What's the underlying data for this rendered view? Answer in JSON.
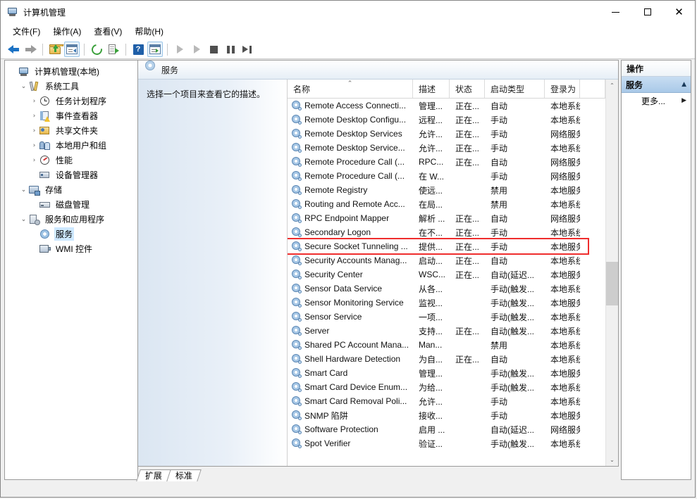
{
  "window": {
    "title": "计算机管理",
    "title_icon": "computer-management-icon",
    "controls": {
      "minimize": "—",
      "maximize": "□",
      "close": "✕"
    }
  },
  "menubar": [
    {
      "name": "file",
      "label": "文件(F)",
      "accel": "F"
    },
    {
      "name": "action",
      "label": "操作(A)",
      "accel": "A"
    },
    {
      "name": "view",
      "label": "查看(V)",
      "accel": "V"
    },
    {
      "name": "help",
      "label": "帮助(H)",
      "accel": "H"
    }
  ],
  "toolbar": [
    {
      "name": "back-button",
      "icon": "back-arrow-icon",
      "enabled": true
    },
    {
      "name": "forward-button",
      "icon": "forward-arrow-icon",
      "enabled": false
    },
    {
      "name": "separator-1",
      "icon": "separator"
    },
    {
      "name": "up-one-level-button",
      "icon": "folder-up-icon"
    },
    {
      "name": "show-hide-console-tree-button",
      "icon": "console-tree-icon",
      "framed": true
    },
    {
      "name": "separator-2",
      "icon": "separator"
    },
    {
      "name": "refresh-button",
      "icon": "refresh-icon"
    },
    {
      "name": "export-list-button",
      "icon": "export-list-icon"
    },
    {
      "name": "separator-3",
      "icon": "separator"
    },
    {
      "name": "help-button",
      "icon": "help-icon"
    },
    {
      "name": "show-hide-action-pane-button",
      "icon": "action-pane-icon",
      "framed": true
    },
    {
      "name": "separator-4",
      "icon": "separator"
    },
    {
      "name": "start-service-button",
      "icon": "play-icon"
    },
    {
      "name": "resume-service-button",
      "icon": "play-icon"
    },
    {
      "name": "stop-service-button",
      "icon": "stop-icon"
    },
    {
      "name": "pause-service-button",
      "icon": "pause-icon"
    },
    {
      "name": "restart-service-button",
      "icon": "restart-icon"
    }
  ],
  "tree": [
    {
      "label": "计算机管理(本地)",
      "icon": "computer-icon",
      "indent": 0,
      "twisty": "",
      "selected": false
    },
    {
      "label": "系统工具",
      "icon": "system-tools-icon",
      "indent": 1,
      "twisty": "expanded",
      "selected": false
    },
    {
      "label": "任务计划程序",
      "icon": "task-scheduler-icon",
      "indent": 2,
      "twisty": "collapsed",
      "selected": false
    },
    {
      "label": "事件查看器",
      "icon": "event-viewer-icon",
      "indent": 2,
      "twisty": "collapsed",
      "selected": false
    },
    {
      "label": "共享文件夹",
      "icon": "shared-folders-icon",
      "indent": 2,
      "twisty": "collapsed",
      "selected": false
    },
    {
      "label": "本地用户和组",
      "icon": "local-users-groups-icon",
      "indent": 2,
      "twisty": "collapsed",
      "selected": false
    },
    {
      "label": "性能",
      "icon": "performance-icon",
      "indent": 2,
      "twisty": "collapsed",
      "selected": false
    },
    {
      "label": "设备管理器",
      "icon": "device-manager-icon",
      "indent": 2,
      "twisty": "",
      "selected": false
    },
    {
      "label": "存储",
      "icon": "storage-icon",
      "indent": 1,
      "twisty": "expanded",
      "selected": false
    },
    {
      "label": "磁盘管理",
      "icon": "disk-management-icon",
      "indent": 2,
      "twisty": "",
      "selected": false
    },
    {
      "label": "服务和应用程序",
      "icon": "services-applications-icon",
      "indent": 1,
      "twisty": "expanded",
      "selected": false
    },
    {
      "label": "服务",
      "icon": "services-icon",
      "indent": 2,
      "twisty": "",
      "selected": true
    },
    {
      "label": "WMI 控件",
      "icon": "wmi-control-icon",
      "indent": 2,
      "twisty": "",
      "selected": false
    }
  ],
  "mmc": {
    "header_title": "服务",
    "header_icon": "services-gear-icon",
    "description_placeholder": "选择一个项目来查看它的描述。"
  },
  "list": {
    "columns": [
      {
        "name": "name",
        "label": "名称",
        "sorted": "asc",
        "sort_glyph": "⌃"
      },
      {
        "name": "description",
        "label": "描述",
        "sorted": ""
      },
      {
        "name": "status",
        "label": "状态",
        "sorted": ""
      },
      {
        "name": "startup_type",
        "label": "启动类型",
        "sorted": ""
      },
      {
        "name": "log_on_as",
        "label": "登录为",
        "sorted": ""
      }
    ],
    "highlighted_row_index": 10,
    "rows": [
      {
        "name": "Remote Access Connecti...",
        "description": "管理...",
        "status": "正在...",
        "startup_type": "自动",
        "log_on_as": "本地系统"
      },
      {
        "name": "Remote Desktop Configu...",
        "description": "远程...",
        "status": "正在...",
        "startup_type": "手动",
        "log_on_as": "本地系统"
      },
      {
        "name": "Remote Desktop Services",
        "description": "允许...",
        "status": "正在...",
        "startup_type": "手动",
        "log_on_as": "网络服务"
      },
      {
        "name": "Remote Desktop Service...",
        "description": "允许...",
        "status": "正在...",
        "startup_type": "手动",
        "log_on_as": "本地系统"
      },
      {
        "name": "Remote Procedure Call (...",
        "description": "RPC...",
        "status": "正在...",
        "startup_type": "自动",
        "log_on_as": "网络服务"
      },
      {
        "name": "Remote Procedure Call (...",
        "description": "在 W...",
        "status": "",
        "startup_type": "手动",
        "log_on_as": "网络服务"
      },
      {
        "name": "Remote Registry",
        "description": "使远...",
        "status": "",
        "startup_type": "禁用",
        "log_on_as": "本地服务"
      },
      {
        "name": "Routing and Remote Acc...",
        "description": "在局...",
        "status": "",
        "startup_type": "禁用",
        "log_on_as": "本地系统"
      },
      {
        "name": "RPC Endpoint Mapper",
        "description": "解析 ...",
        "status": "正在...",
        "startup_type": "自动",
        "log_on_as": "网络服务"
      },
      {
        "name": "Secondary Logon",
        "description": "在不...",
        "status": "正在...",
        "startup_type": "手动",
        "log_on_as": "本地系统"
      },
      {
        "name": "Secure Socket Tunneling ...",
        "description": "提供...",
        "status": "正在...",
        "startup_type": "手动",
        "log_on_as": "本地服务"
      },
      {
        "name": "Security Accounts Manag...",
        "description": "启动...",
        "status": "正在...",
        "startup_type": "自动",
        "log_on_as": "本地系统"
      },
      {
        "name": "Security Center",
        "description": "WSC...",
        "status": "正在...",
        "startup_type": "自动(延迟...",
        "log_on_as": "本地服务"
      },
      {
        "name": "Sensor Data Service",
        "description": "从各...",
        "status": "",
        "startup_type": "手动(触发...",
        "log_on_as": "本地系统"
      },
      {
        "name": "Sensor Monitoring Service",
        "description": "监视...",
        "status": "",
        "startup_type": "手动(触发...",
        "log_on_as": "本地服务"
      },
      {
        "name": "Sensor Service",
        "description": "一项...",
        "status": "",
        "startup_type": "手动(触发...",
        "log_on_as": "本地系统"
      },
      {
        "name": "Server",
        "description": "支持...",
        "status": "正在...",
        "startup_type": "自动(触发...",
        "log_on_as": "本地系统"
      },
      {
        "name": "Shared PC Account Mana...",
        "description": "Man...",
        "status": "",
        "startup_type": "禁用",
        "log_on_as": "本地系统"
      },
      {
        "name": "Shell Hardware Detection",
        "description": "为自...",
        "status": "正在...",
        "startup_type": "自动",
        "log_on_as": "本地系统"
      },
      {
        "name": "Smart Card",
        "description": "管理...",
        "status": "",
        "startup_type": "手动(触发...",
        "log_on_as": "本地服务"
      },
      {
        "name": "Smart Card Device Enum...",
        "description": "为给...",
        "status": "",
        "startup_type": "手动(触发...",
        "log_on_as": "本地系统"
      },
      {
        "name": "Smart Card Removal Poli...",
        "description": "允许...",
        "status": "",
        "startup_type": "手动",
        "log_on_as": "本地系统"
      },
      {
        "name": "SNMP 陷阱",
        "description": "接收...",
        "status": "",
        "startup_type": "手动",
        "log_on_as": "本地服务"
      },
      {
        "name": "Software Protection",
        "description": "启用 ...",
        "status": "",
        "startup_type": "自动(延迟...",
        "log_on_as": "网络服务"
      },
      {
        "name": "Spot Verifier",
        "description": "验证...",
        "status": "",
        "startup_type": "手动(触发...",
        "log_on_as": "本地系统"
      }
    ]
  },
  "scrollbar": {
    "up_glyph": "⌃",
    "down_glyph": "⌄",
    "thumb_top_pct": 47,
    "thumb_height_pct": 12
  },
  "tabs": [
    {
      "name": "extended",
      "label": "扩展",
      "active": false
    },
    {
      "name": "standard",
      "label": "标准",
      "active": true
    }
  ],
  "actions": {
    "title": "操作",
    "group_label": "服务",
    "group_caret": "▲",
    "items": [
      {
        "name": "more-actions",
        "label": "更多...",
        "caret": "▶"
      }
    ]
  },
  "colors": {
    "accent": "#a9c9e8",
    "highlight_red": "#ef2d2d",
    "selection_blue": "#cde8ff",
    "window_bg": "#f0f0f0"
  }
}
